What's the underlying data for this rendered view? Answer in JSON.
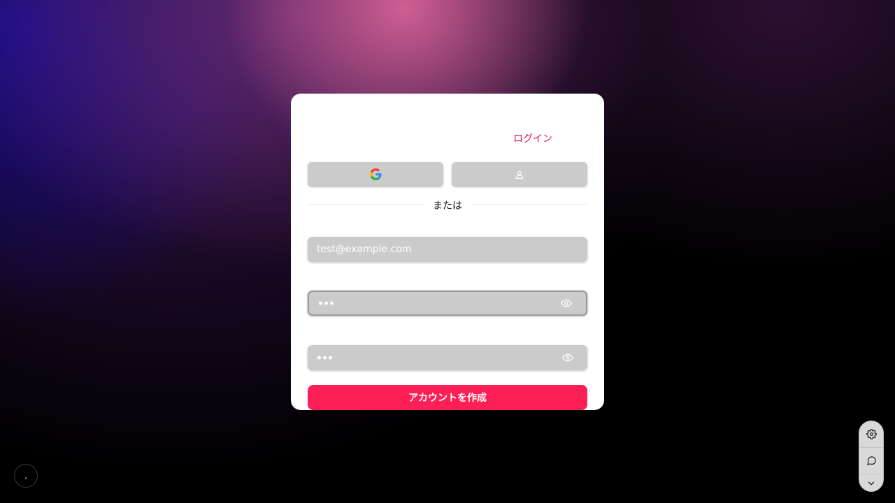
{
  "login_link": "ログイン",
  "divider_text": "または",
  "social": {
    "google_icon": "google-icon",
    "guest_icon": "user-icon"
  },
  "form": {
    "email_placeholder": "test@example.com",
    "password_value": "•••",
    "confirm_password_value": "•••",
    "submit_label": "アカウントを作成"
  },
  "corner_button_label": ",",
  "toolbar": {
    "items": [
      "gear-icon",
      "chat-icon",
      "chevron-down-icon"
    ]
  },
  "colors": {
    "accent": "#ff1f57",
    "link": "#e0115f",
    "field_bg": "#cbcbcb"
  }
}
